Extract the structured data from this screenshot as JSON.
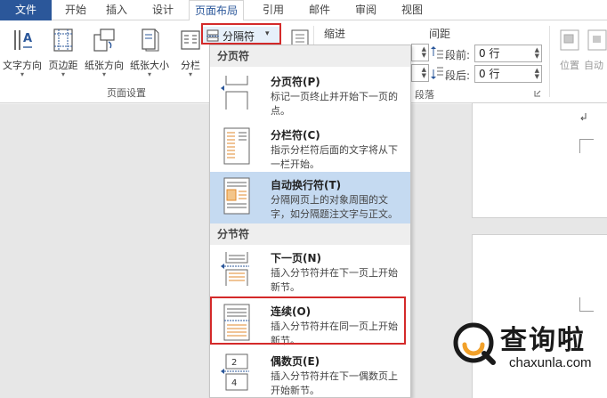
{
  "tabs": [
    "文件",
    "开始",
    "插入",
    "设计",
    "页面布局",
    "引用",
    "邮件",
    "审阅",
    "视图"
  ],
  "ribbon": {
    "buttons": [
      {
        "label": "文字方向",
        "arrow": "▾"
      },
      {
        "label": "页边距",
        "arrow": "▾"
      },
      {
        "label": "纸张方向",
        "arrow": "▾"
      },
      {
        "label": "纸张大小",
        "arrow": "▾"
      },
      {
        "label": "分栏",
        "arrow": "▾"
      }
    ],
    "breaks_button": "分隔符",
    "breaks_arrow": "▾",
    "page_setup_group": "页面设置",
    "indent_label": "缩进",
    "spacing_label": "间距",
    "before_label": "段前:",
    "before_value": "0 行",
    "after_label": "段后:",
    "after_value": "0 行",
    "paragraph_group": "段落",
    "position_label": "位置",
    "autowrap_label": "自动"
  },
  "dropdown": {
    "sections": [
      {
        "header": "分页符",
        "items": [
          {
            "title": "分页符(P)",
            "desc": "标记一页终止并开始下一页的点。",
            "highlighted": false,
            "icon": "page-break-icon"
          },
          {
            "title": "分栏符(C)",
            "desc": "指示分栏符后面的文字将从下一栏开始。",
            "highlighted": false,
            "icon": "column-break-icon"
          },
          {
            "title": "自动换行符(T)",
            "desc": "分隔网页上的对象周围的文字，如分隔题注文字与正文。",
            "highlighted": true,
            "icon": "text-wrapping-icon"
          }
        ]
      },
      {
        "header": "分节符",
        "items": [
          {
            "title": "下一页(N)",
            "desc": "插入分节符并在下一页上开始新节。",
            "highlighted": false,
            "icon": "next-page-icon"
          },
          {
            "title": "连续(O)",
            "desc": "插入分节符并在同一页上开始新节。",
            "highlighted": false,
            "icon": "continuous-icon"
          },
          {
            "title": "偶数页(E)",
            "desc": "插入分节符并在下一偶数页上开始新节。",
            "highlighted": false,
            "icon": "even-page-icon"
          }
        ]
      }
    ]
  },
  "watermark": {
    "text": "查询啦",
    "url": "chaxunla.com"
  },
  "colors": {
    "file_tab": "#2b579a",
    "highlight": "#c5daf1",
    "red_box": "#d42a2a",
    "watermark_accent": "#f2a12a"
  }
}
